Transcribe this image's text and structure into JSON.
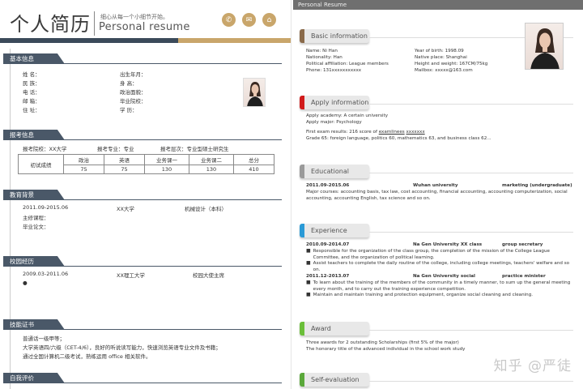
{
  "left": {
    "title_cn": "个人简历",
    "tagline": "细心从每一个小细节开始。",
    "title_en": "Personal resume",
    "icons": [
      "phone-icon",
      "mail-icon",
      "location-icon"
    ],
    "sections": {
      "basic": "基本信息",
      "apply": "报考信息",
      "edu": "教育背景",
      "campus": "校园经历",
      "skills": "技能证书",
      "self": "自我评价"
    },
    "basic_left": [
      "姓 名：",
      "民 族：",
      "电 话：",
      "邮 箱：",
      "住 址："
    ],
    "basic_right": [
      "出生年月：",
      "身 高：",
      "政治面貌：",
      "毕业院校：",
      "学 历："
    ],
    "apply_line": {
      "school": "报考院校：XX大学",
      "major": "报考专业：专业",
      "degree": "报考层次：专业型硕士研究生"
    },
    "score_table": {
      "row_label": "初试成绩",
      "headers": [
        "政治",
        "英语",
        "业务课一",
        "业务课二",
        "总分"
      ],
      "values": [
        "75",
        "75",
        "130",
        "130",
        "410"
      ]
    },
    "edu": {
      "date": "2011.09-2015.06",
      "school": "XX大学",
      "major": "机械设计（本科）",
      "courses": "主修课程：",
      "thesis": "毕业论文："
    },
    "campus": {
      "date": "2009.03-2011.06",
      "school": "XX理工大学",
      "role": "校园大使主席",
      "bullet": "●"
    },
    "skills": [
      "普通话一级甲等；",
      "大学英语四/六级（CET-4/6），良好的听说读写能力，快速浏览英语专业文件及书籍；",
      "通过全国计算机二级考试，熟练运用 office 相关软件。"
    ]
  },
  "right": {
    "top_bar": "Personal Resume",
    "colors": {
      "basic": "#8a6a4a",
      "apply": "#d11b1b",
      "edu": "#9a9a9a",
      "exp": "#2a9ad6",
      "award": "#6bbf3a",
      "self": "#5aa83a"
    },
    "sections": {
      "basic": "Basic information",
      "apply": "Apply information",
      "edu": "Educational",
      "exp": "Experience",
      "award": "Award",
      "self": "Self-evaluation"
    },
    "basic_left": [
      "Name: Ni Han",
      "Nationality: Han",
      "Political affiliation: League members",
      "Phone: 131xxxxxxxxxxx"
    ],
    "basic_right": [
      "Year of birth: 1998.09",
      "Native place: Shanghai",
      "Height and weight: 167CM/75kg",
      "Mailbox: xxxxx@163.com"
    ],
    "apply": {
      "academy": "Apply academy: A certain university",
      "major": "Apply major: Psychology",
      "exam_prefix": "First exam results: 216 score of ",
      "exam_link": "examlinees",
      "exam_link2": "xxxxxxx",
      "grades": "Grade 65: foreign language, politics 60, mathematics 63, and business class 62..."
    },
    "edu": {
      "date": "2011.09-2015.06",
      "school": "Wuhan university",
      "degree": "marketing (undergraduate)",
      "courses": "Major courses: accounting basis, tax law, cost accounting, financial accounting, accounting computerization, social accounting, accounting English, tax science and so on."
    },
    "exp": [
      {
        "date": "2010.09-2014.07",
        "org": "Na Gen University XX class",
        "role": "group secretary",
        "bullets": [
          "Responsible for the organization of the class group, the completion of the mission of the College League Committee, and the organization of political learning.",
          "Assist teachers to complete the daily routine of the college, including college meetings, teachers' welfare and so on."
        ]
      },
      {
        "date": "2011.12-2013.07",
        "org": "Na Gen University social",
        "role": "practice minister",
        "bullets": [
          "To learn about the training of the members of the community in a timely manner, to sum up the general meeting every month, and to carry out the training experience competition.",
          "Maintain and maintain training and protection equipment, organize social cleaning and cleaning."
        ]
      }
    ],
    "award": [
      "Three awards for 2 outstanding Scholarships (first 5% of the major)",
      "The honorary title of the advanced individual in the school work study"
    ],
    "watermark": "知乎 @严徒"
  }
}
